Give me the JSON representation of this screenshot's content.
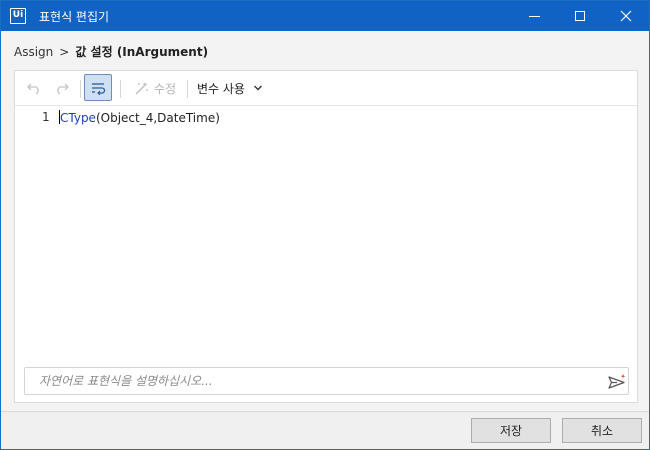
{
  "window": {
    "app_logo": "Ui",
    "title": "표현식 편집기",
    "controls": [
      "minimize-icon",
      "maximize-icon",
      "close-icon"
    ]
  },
  "breadcrumb": {
    "parent": "Assign",
    "separator": ">",
    "current": "값 설정 (InArgument)"
  },
  "toolbar": {
    "undo_icon": "undo-icon",
    "redo_icon": "redo-icon",
    "wrap_icon": "word-wrap-icon",
    "wrap_active": true,
    "edit_label": "수정",
    "edit_icon": "magic-wand-icon",
    "edit_enabled": false,
    "variables_label": "변수 사용",
    "variables_icon": "chevron-down-icon"
  },
  "editor": {
    "lines": [
      {
        "number": "1",
        "keyword": "CType",
        "rest": "(Object_4,DateTime)"
      }
    ]
  },
  "nl_prompt": {
    "placeholder": "자연어로 표현식을 설명하십시오...",
    "value": "",
    "send_icon": "sparkle-send-icon"
  },
  "footer": {
    "save_label": "저장",
    "cancel_label": "취소"
  },
  "colors": {
    "titlebar": "#0e63c4",
    "keyword": "#1f3fbf",
    "wrap_active_bg": "#cfe0f3",
    "send_sparkle": "#e0421f"
  }
}
